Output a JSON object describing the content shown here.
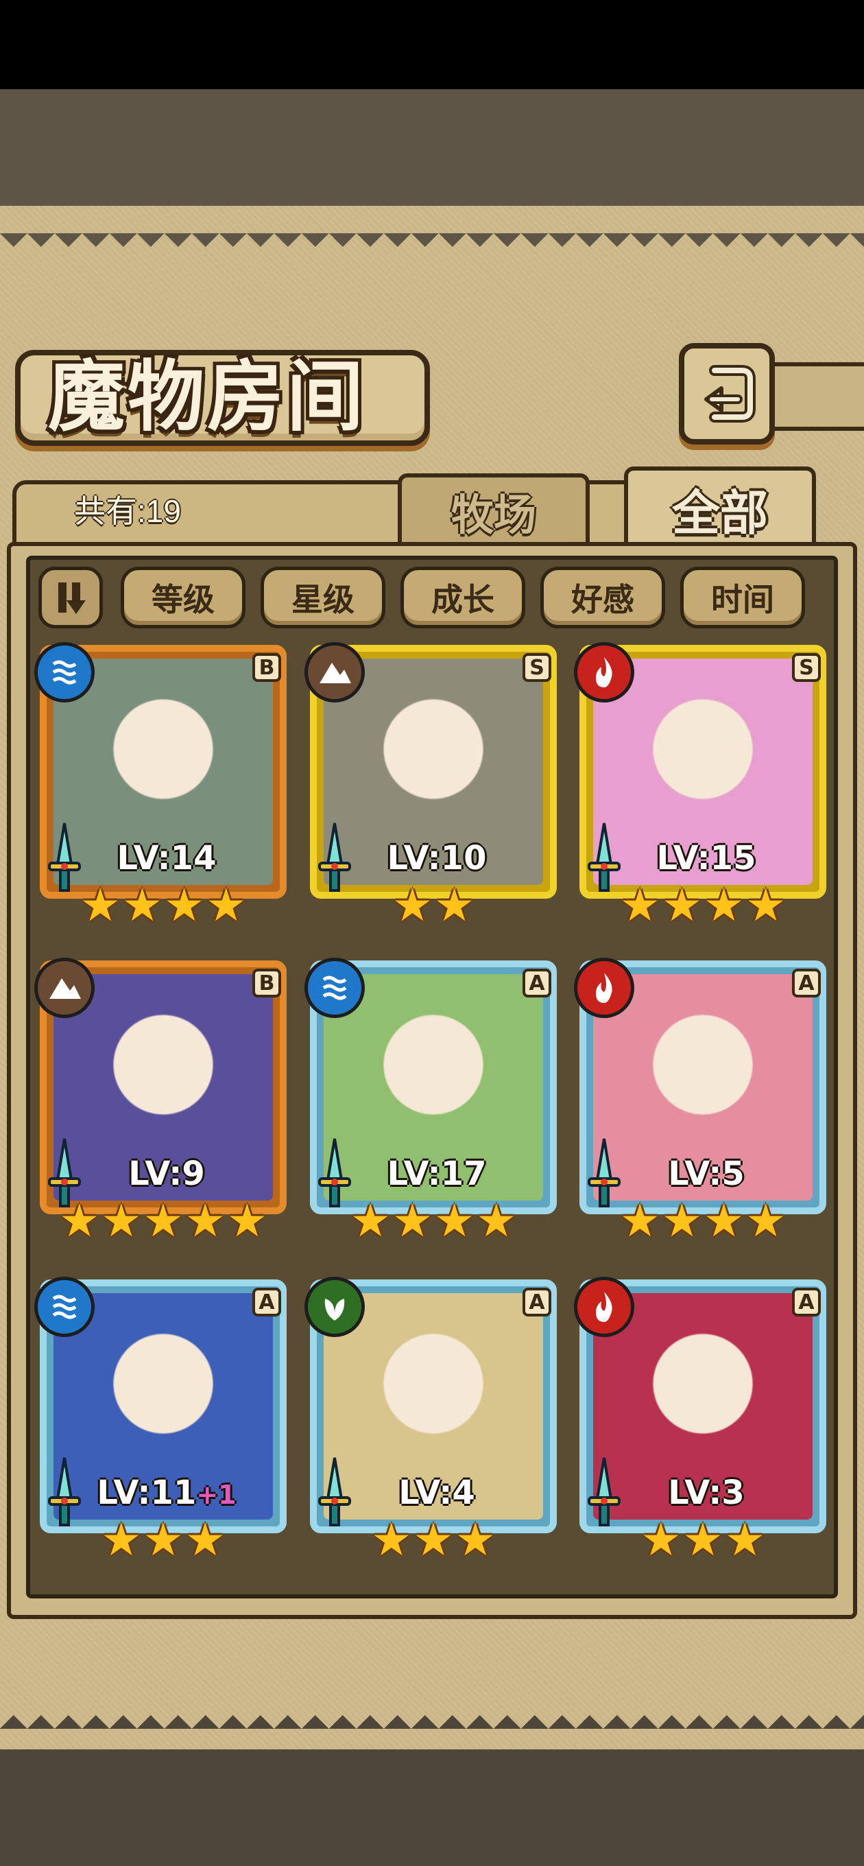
{
  "screen": {
    "title": "魔物房间",
    "count_label": "共有:19",
    "tabs": [
      {
        "label": "牧场",
        "active": false
      },
      {
        "label": "全部",
        "active": true
      }
    ],
    "sort_buttons": [
      "等级",
      "星级",
      "成长",
      "好感",
      "时间"
    ],
    "back_icon": "return-arrow-icon",
    "sort_toggle_icon": "sort-order-icon"
  },
  "monsters": [
    {
      "element": "water",
      "rank": "B",
      "level": "LV:14",
      "bonus": "",
      "stars": 4,
      "frame": "orange",
      "portrait": "#7a8f7c"
    },
    {
      "element": "earth",
      "rank": "S",
      "level": "LV:10",
      "bonus": "",
      "stars": 2,
      "frame": "gold",
      "portrait": "#8c8c78"
    },
    {
      "element": "fire",
      "rank": "S",
      "level": "LV:15",
      "bonus": "",
      "stars": 4,
      "frame": "gold",
      "portrait": "#e79fcf"
    },
    {
      "element": "earth",
      "rank": "B",
      "level": "LV:9",
      "bonus": "",
      "stars": 5,
      "frame": "orange",
      "portrait": "#5a4f9b"
    },
    {
      "element": "water",
      "rank": "A",
      "level": "LV:17",
      "bonus": "",
      "stars": 4,
      "frame": "blue",
      "portrait": "#8fbf6f"
    },
    {
      "element": "fire",
      "rank": "A",
      "level": "LV:5",
      "bonus": "",
      "stars": 4,
      "frame": "blue",
      "portrait": "#e58ea0"
    },
    {
      "element": "water",
      "rank": "A",
      "level": "LV:11",
      "bonus": "+1",
      "stars": 3,
      "frame": "blue",
      "portrait": "#3e5fb8"
    },
    {
      "element": "grass",
      "rank": "A",
      "level": "LV:4",
      "bonus": "",
      "stars": 3,
      "frame": "blue",
      "portrait": "#d8c58c"
    },
    {
      "element": "fire",
      "rank": "A",
      "level": "LV:3",
      "bonus": "",
      "stars": 3,
      "frame": "blue",
      "portrait": "#b8324f"
    }
  ],
  "colors": {
    "parchment": "#cdbb8d",
    "outline": "#3b2a16",
    "star": "#ffc21a",
    "water": "#1f78c9",
    "earth": "#6b4a34",
    "fire": "#c8221c",
    "grass": "#2e6f24"
  }
}
